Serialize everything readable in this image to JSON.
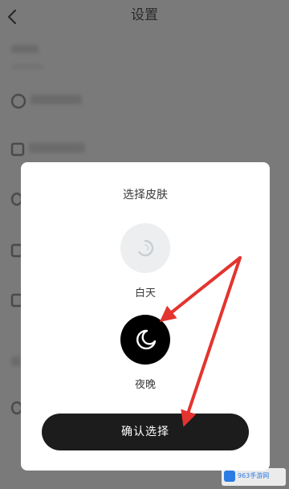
{
  "header": {
    "title": "设置"
  },
  "dialog": {
    "title": "选择皮肤",
    "options": [
      {
        "label": "白天",
        "icon": "sun-icon",
        "selected": false
      },
      {
        "label": "夜晚",
        "icon": "moon-icon",
        "selected": true
      }
    ],
    "confirm_label": "确认选择"
  },
  "watermark": {
    "text": "963手游网"
  },
  "colors": {
    "overlay": "#7a7a7a",
    "sheet": "#ffffff",
    "button": "#1c1c1c",
    "arrow": "#e3342f",
    "accent": "#2b7be4"
  }
}
